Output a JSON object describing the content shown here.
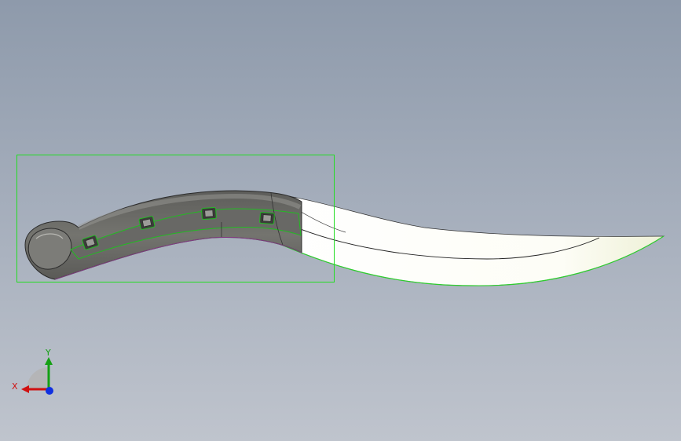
{
  "viewport": {
    "background_top": "#8e9aab",
    "background_bottom": "#bfc4cd",
    "selection_color": "#22dd22"
  },
  "model": {
    "name": "curved-blade-knife",
    "handle_color": "#6e6e6b",
    "blade_color": "#ffffff",
    "slot_count": 4
  },
  "triad": {
    "x_label": "X",
    "y_label": "Y",
    "x_color": "#d01010",
    "y_color": "#14a014",
    "z_color": "#1030e0"
  }
}
